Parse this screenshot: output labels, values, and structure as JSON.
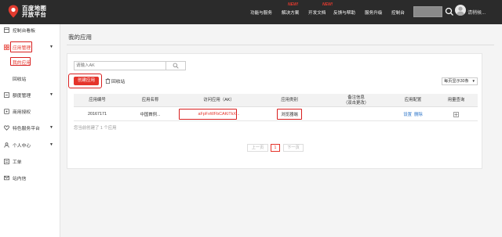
{
  "header": {
    "logo_line1": "百度地图",
    "logo_line2": "开放平台",
    "nav": [
      {
        "label": "功能与服务"
      },
      {
        "label": "解决方案",
        "badge": "NEW!"
      },
      {
        "label": "开发文档"
      },
      {
        "label": "反馈与帮助",
        "badge": "NEW!"
      },
      {
        "label": "服务升级"
      },
      {
        "label": "控制台"
      }
    ],
    "login_label": "请稍候..."
  },
  "sidebar": {
    "items": [
      {
        "label": "控制台看板",
        "icon": "dashboard-icon"
      },
      {
        "label": "应用管理",
        "icon": "app-grid-icon",
        "expanded": true
      },
      {
        "label": "额度管理",
        "icon": "quota-icon"
      },
      {
        "label": "商用授权",
        "icon": "license-icon"
      },
      {
        "label": "特色服务平台",
        "icon": "heart-icon"
      },
      {
        "label": "个人中心",
        "icon": "person-icon"
      },
      {
        "label": "工单",
        "icon": "ticket-icon"
      },
      {
        "label": "站内信",
        "icon": "mail-icon"
      }
    ],
    "subitems": [
      {
        "label": "我的应用",
        "active": true
      },
      {
        "label": "回收站"
      }
    ]
  },
  "main": {
    "title": "我的应用",
    "search_placeholder": "请输入AK",
    "create_label": "创建应用",
    "recycle_label": "回收站",
    "page_size_label": "每页显示30条",
    "columns": [
      "应用编号",
      "应用名称",
      "访问应用（AK）",
      "应用类别",
      "备注信息\n（双击更改）",
      "应用配置",
      "用量查询"
    ],
    "rows": [
      {
        "id": "20167171",
        "name": "中国首例...",
        "ak": "aFpFxWFbCAKiTkX...",
        "category": "浏览器端",
        "note": "",
        "config": [
          "设置",
          "删除"
        ]
      }
    ],
    "count_text": "您当前创建了 1 个应用",
    "pagination": {
      "prev": "上一页",
      "current": "1",
      "next": "下一页"
    }
  },
  "colors": {
    "accent": "#e5332a",
    "topbar": "#2b2b2b",
    "highlight_box": "#d81e1e",
    "link": "#2a73c8"
  }
}
